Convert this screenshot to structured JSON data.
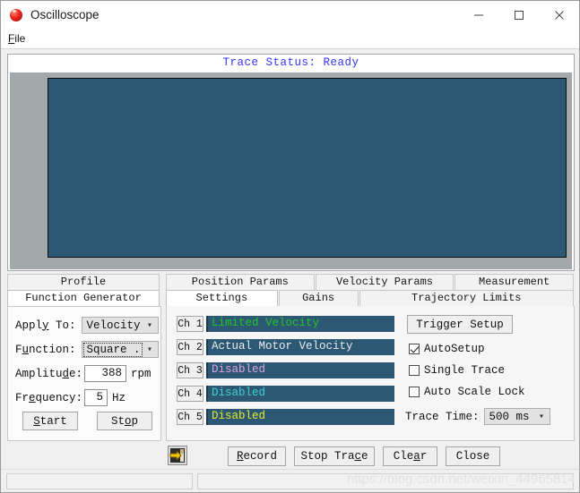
{
  "window": {
    "title": "Oscilloscope",
    "icon": "red-sphere-icon",
    "controls": {
      "minimize": "minimize-icon",
      "maximize": "maximize-icon",
      "close": "close-icon"
    }
  },
  "menubar": {
    "items": [
      {
        "label": "File",
        "mnemonic": "F"
      }
    ]
  },
  "scope": {
    "status_label": "Trace Status:",
    "status_value": "Ready",
    "status_text": "Trace Status:  Ready",
    "plot_background": "#2d5873",
    "panel_background": "#a3a9ab",
    "status_color": "#3333ff"
  },
  "tabs_left": {
    "row1": [
      {
        "label": "Profile",
        "selected": false
      }
    ],
    "row2": [
      {
        "label": "Function Generator",
        "selected": true
      }
    ]
  },
  "tabs_right": {
    "row1": [
      {
        "label": "Position Params",
        "selected": false
      },
      {
        "label": "Velocity Params",
        "selected": false
      },
      {
        "label": "Measurement",
        "selected": false
      }
    ],
    "row2": [
      {
        "label": "Settings",
        "selected": true
      },
      {
        "label": "Gains",
        "selected": false
      },
      {
        "label": "Trajectory Limits",
        "selected": false
      }
    ]
  },
  "function_generator": {
    "apply_to": {
      "label": "Apply To:",
      "mnemonic": "y",
      "value": "Velocity"
    },
    "function": {
      "label": "Function:",
      "mnemonic": "u",
      "value": "Square ...",
      "focused": true
    },
    "amplitude": {
      "label": "Amplitude:",
      "mnemonic": "d",
      "value": "388",
      "unit": "rpm"
    },
    "frequency": {
      "label": "Frequency:",
      "mnemonic": "e",
      "value": "5",
      "unit": "Hz"
    },
    "start_button": {
      "label": "Start",
      "mnemonic": "S"
    },
    "stop_button": {
      "label": "Stop",
      "mnemonic": "o"
    }
  },
  "channels": [
    {
      "button": "Ch 1",
      "value": "Limited Velocity",
      "color": "#22c52a"
    },
    {
      "button": "Ch 2",
      "value": "Actual Motor Velocity",
      "color": "#e9eef2"
    },
    {
      "button": "Ch 3",
      "value": "Disabled",
      "color": "#e3a3e3"
    },
    {
      "button": "Ch 4",
      "value": "Disabled",
      "color": "#3fd2d2"
    },
    {
      "button": "Ch 5",
      "value": "Disabled",
      "color": "#e8e82a"
    }
  ],
  "settings": {
    "trigger_setup_button": "Trigger Setup",
    "auto_setup": {
      "label": "AutoSetup",
      "checked": true
    },
    "single_trace": {
      "label": "Single Trace",
      "checked": false
    },
    "auto_scale_lock": {
      "label": "Auto Scale Lock",
      "checked": false
    },
    "trace_time": {
      "label": "Trace Time:",
      "value": "500 ms"
    }
  },
  "actions": {
    "save_icon": "save-export-icon",
    "record": {
      "label": "Record",
      "mnemonic": "R"
    },
    "stop_trace": {
      "label": "Stop Trace",
      "mnemonic": "c"
    },
    "clear": {
      "label": "Clear",
      "mnemonic": "a"
    },
    "close": {
      "label": "Close"
    }
  },
  "statusbar": {
    "pane1": "",
    "pane2": ""
  },
  "watermark": "https://blog.csdn.net/weixin_44965814"
}
